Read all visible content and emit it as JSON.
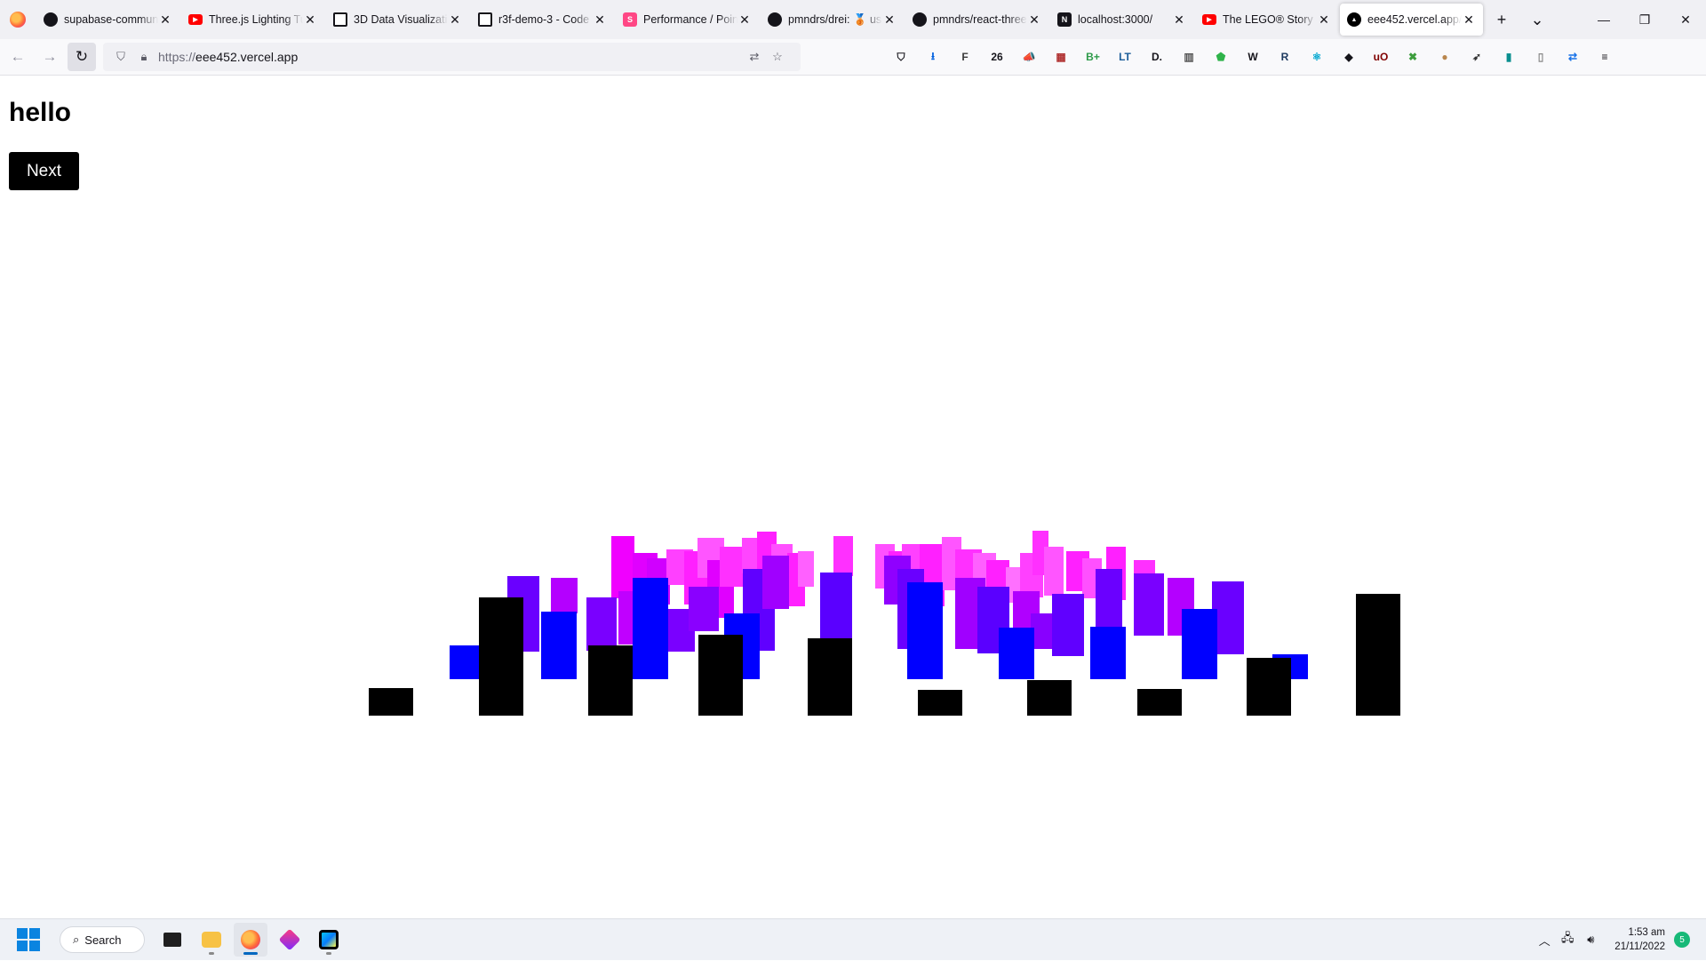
{
  "browser": {
    "tabs": [
      {
        "title": "supabase-commun",
        "icon": "github-icon",
        "color": "#15141a"
      },
      {
        "title": "Three.js Lighting Tu",
        "icon": "youtube-icon",
        "color": "#ff0000"
      },
      {
        "title": "3D Data Visualizatio",
        "icon": "codesandbox-icon",
        "color": "#15141a"
      },
      {
        "title": "r3f-demo-3 - Code",
        "icon": "codesandbox-icon",
        "color": "#15141a"
      },
      {
        "title": "Performance / Point",
        "icon": "storybook-icon",
        "color": "#ff4785"
      },
      {
        "title": "pmndrs/drei: 🥉 us",
        "icon": "github-icon",
        "color": "#15141a"
      },
      {
        "title": "pmndrs/react-three",
        "icon": "github-icon",
        "color": "#15141a"
      },
      {
        "title": "localhost:3000/",
        "icon": "nextjs-icon",
        "color": "#15141a"
      },
      {
        "title": "The LEGO® Story -",
        "icon": "youtube-icon",
        "color": "#ff0000"
      },
      {
        "title": "eee452.vercel.app/",
        "icon": "vercel-icon",
        "color": "#000000",
        "active": true
      }
    ],
    "new_tab_label": "+",
    "tab_list_label": "⌄",
    "url_scheme": "https://",
    "url_host": "eee452.vercel.app",
    "extensions": [
      {
        "name": "pocket-icon",
        "label": "⛉",
        "color": "#15141a"
      },
      {
        "name": "download-icon",
        "label": "⭳",
        "color": "#0060df"
      },
      {
        "name": "ext-f-icon",
        "label": "F",
        "color": "#3a3a3a"
      },
      {
        "name": "ext-26-badge",
        "label": "26",
        "color": "#15141a"
      },
      {
        "name": "ext-megaphone-icon",
        "label": "📣",
        "color": "#d35400"
      },
      {
        "name": "ext-calendar-icon",
        "label": "▦",
        "color": "#b03030"
      },
      {
        "name": "ext-b-plus-icon",
        "label": "B+",
        "color": "#2e9b4a"
      },
      {
        "name": "ext-lt-icon",
        "label": "LT",
        "color": "#1c5d99"
      },
      {
        "name": "ext-d-icon",
        "label": "D.",
        "color": "#15141a"
      },
      {
        "name": "ext-bars-icon",
        "label": "▥",
        "color": "#555555"
      },
      {
        "name": "ext-shield-icon",
        "label": "⬟",
        "color": "#2fb34a"
      },
      {
        "name": "ext-w-icon",
        "label": "W",
        "color": "#15141a"
      },
      {
        "name": "ext-r-icon",
        "label": "R",
        "color": "#1e3a5f"
      },
      {
        "name": "ext-react-icon",
        "label": "⚛",
        "color": "#00a7d0"
      },
      {
        "name": "ext-cat-icon",
        "label": "◆",
        "color": "#15141a"
      },
      {
        "name": "ext-ublock-icon",
        "label": "uO",
        "color": "#800000"
      },
      {
        "name": "ext-tools-icon",
        "label": "✖",
        "color": "#3d9d3d"
      },
      {
        "name": "ext-cookie-icon",
        "label": "●",
        "color": "#b9864d"
      },
      {
        "name": "ext-feather-icon",
        "label": "➶",
        "color": "#333333"
      },
      {
        "name": "ext-book-icon",
        "label": "▮",
        "color": "#0a8f8f"
      },
      {
        "name": "ext-reader-icon",
        "label": "▯",
        "color": "#8a8a8a"
      },
      {
        "name": "ext-translate-icon",
        "label": "⇄",
        "color": "#1a73e8"
      },
      {
        "name": "menu-icon",
        "label": "≡",
        "color": "#15141a"
      }
    ]
  },
  "page": {
    "heading": "hello",
    "next_button": "Next"
  },
  "taskbar": {
    "search_label": "Search",
    "time": "1:53 am",
    "date": "21/11/2022",
    "notification_count": "5"
  }
}
